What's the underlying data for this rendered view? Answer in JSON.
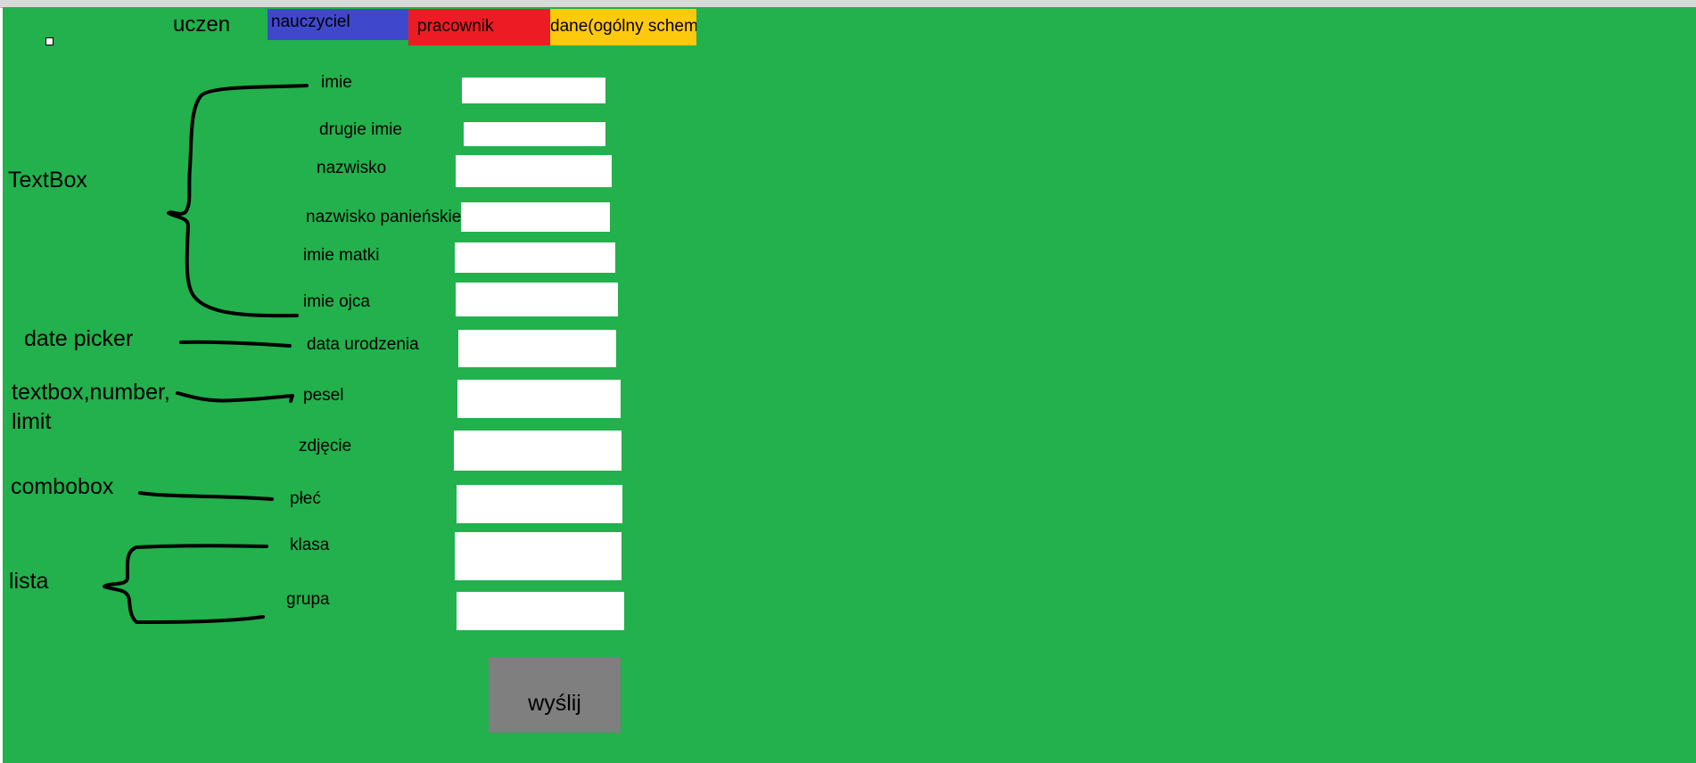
{
  "tabs": {
    "uczen": "uczen",
    "nauczyciel": "nauczyciel",
    "pracownik": "pracownik",
    "dane": "dane(ogólny schemat)"
  },
  "annotations": {
    "textbox": "TextBox",
    "date_picker": "date picker",
    "textbox_number_line1": "textbox,number,",
    "textbox_number_line2": "limit",
    "combobox": "combobox",
    "lista": "lista"
  },
  "fields": {
    "imie": {
      "label": "imie",
      "value": ""
    },
    "drugie_imie": {
      "label": "drugie imie",
      "value": ""
    },
    "nazwisko": {
      "label": "nazwisko",
      "value": ""
    },
    "nazwisko_panienskie": {
      "label": "nazwisko panieńskie",
      "value": ""
    },
    "imie_matki": {
      "label": "imie matki",
      "value": ""
    },
    "imie_ojca": {
      "label": "imie ojca",
      "value": ""
    },
    "data_urodzenia": {
      "label": "data urodzenia",
      "value": ""
    },
    "pesel": {
      "label": "pesel",
      "value": ""
    },
    "zdjecie": {
      "label": "zdjęcie",
      "value": ""
    },
    "plec": {
      "label": "płeć",
      "value": ""
    },
    "klasa": {
      "label": "klasa",
      "value": ""
    },
    "grupa": {
      "label": "grupa",
      "value": ""
    }
  },
  "submit": {
    "label": "wyślij"
  },
  "colors": {
    "background": "#22b14c",
    "tab_nauczyciel": "#3f48cc",
    "tab_pracownik": "#ed1c24",
    "tab_dane": "#ffc90e",
    "submit": "#7f7f7f"
  }
}
